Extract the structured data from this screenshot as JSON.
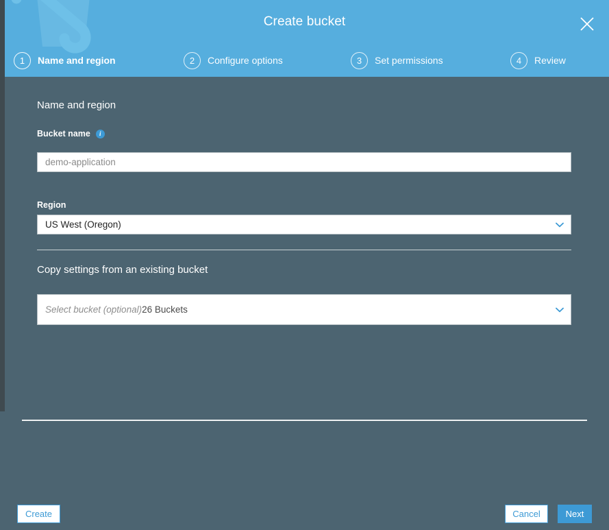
{
  "header": {
    "title": "Create bucket",
    "close_label": "Close",
    "close_icon": "close-icon",
    "watermark_icon": "bucket-watermark-icon",
    "background_color": "#56aede"
  },
  "steps": [
    {
      "number": "1",
      "label": "Name and region",
      "active": true
    },
    {
      "number": "2",
      "label": "Configure options",
      "active": false
    },
    {
      "number": "3",
      "label": "Set permissions",
      "active": false
    },
    {
      "number": "4",
      "label": "Review",
      "active": false
    }
  ],
  "form": {
    "section_title": "Name and region",
    "bucket_name": {
      "label": "Bucket name",
      "info_icon": "info-icon",
      "info_glyph": "i",
      "placeholder": "demo-application",
      "value": ""
    },
    "region": {
      "label": "Region",
      "value": "US West (Oregon)",
      "chevron_icon": "chevron-down-icon"
    },
    "copy_settings": {
      "section_title": "Copy settings from an existing bucket",
      "placeholder": "Select bucket (optional)",
      "count_label": "26 Buckets",
      "chevron_icon": "chevron-down-icon"
    }
  },
  "footer": {
    "create_label": "Create",
    "cancel_label": "Cancel",
    "next_label": "Next"
  },
  "colors": {
    "header_blue": "#56aede",
    "body_slate": "#4c6471",
    "accent_blue": "#3d9ad5",
    "white": "#ffffff"
  }
}
